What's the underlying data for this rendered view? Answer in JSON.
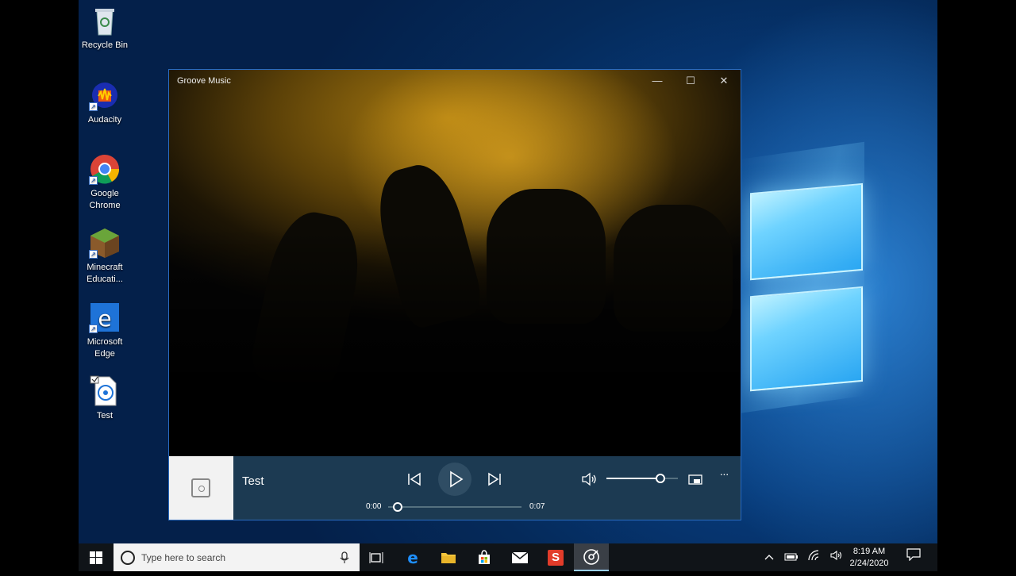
{
  "desktop": {
    "icons": [
      {
        "label": "Recycle Bin"
      },
      {
        "label": "Audacity"
      },
      {
        "label_line1": "Google",
        "label_line2": "Chrome"
      },
      {
        "label_line1": "Minecraft",
        "label_line2": "Educati..."
      },
      {
        "label_line1": "Microsoft",
        "label_line2": "Edge"
      },
      {
        "label": "Test"
      }
    ]
  },
  "window": {
    "title": "Groove Music",
    "minimize_glyph": "—",
    "maximize_glyph": "☐",
    "close_glyph": "✕"
  },
  "player": {
    "track_title": "Test",
    "elapsed": "0:00",
    "duration": "0:07",
    "progress": 0.0,
    "volume": 0.75,
    "more_glyph": "···"
  },
  "taskbar": {
    "search_placeholder": "Type here to search",
    "time": "8:19 AM",
    "date": "2/24/2020",
    "store_icon_glyph": "S"
  },
  "colors": {
    "player_bar": "#1c3a52",
    "accent": "#2a6bc0",
    "taskbar": "#101418"
  }
}
